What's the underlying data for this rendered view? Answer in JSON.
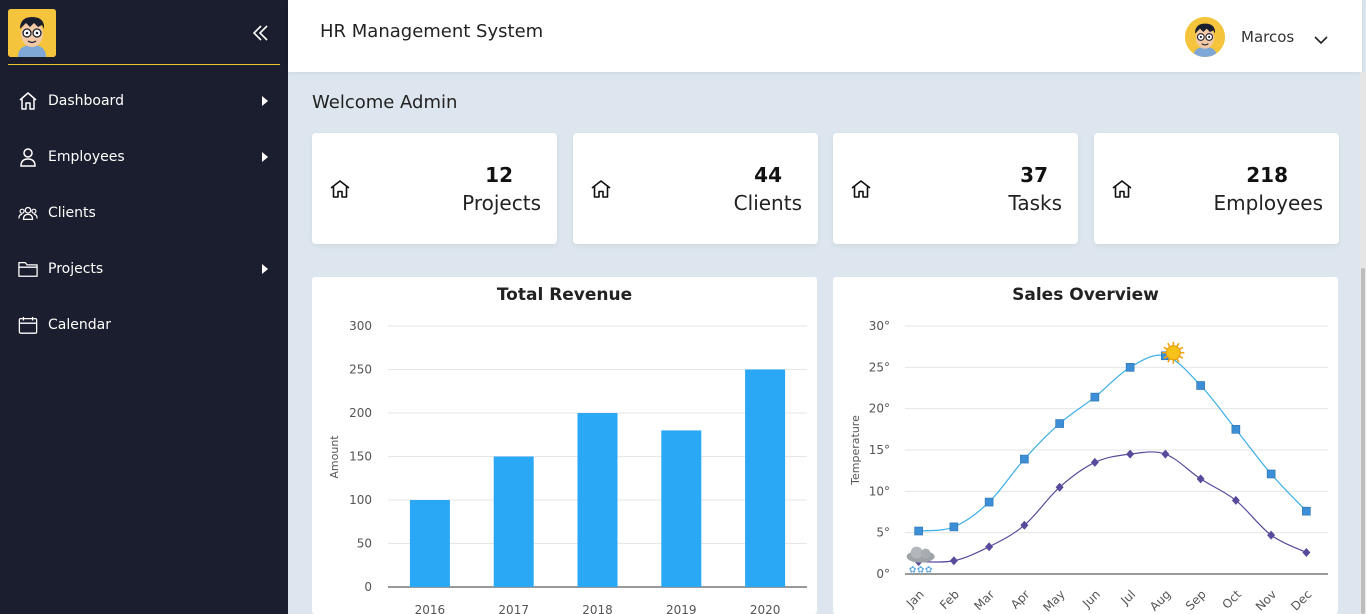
{
  "sidebar": {
    "items": [
      {
        "label": "Dashboard",
        "icon": "home-icon",
        "has_arrow": true
      },
      {
        "label": "Employees",
        "icon": "user-icon",
        "has_arrow": true
      },
      {
        "label": "Clients",
        "icon": "users-icon",
        "has_arrow": false
      },
      {
        "label": "Projects",
        "icon": "folder-icon",
        "has_arrow": true
      },
      {
        "label": "Calendar",
        "icon": "calendar-icon",
        "has_arrow": false
      }
    ],
    "divider_color": "#e9c431",
    "background": "#1b1e2e"
  },
  "header": {
    "title": "HR Management System",
    "user_name": "Marcos"
  },
  "welcome": "Welcome Admin",
  "stats": [
    {
      "value": "12",
      "label": "Projects"
    },
    {
      "value": "44",
      "label": "Clients"
    },
    {
      "value": "37",
      "label": "Tasks"
    },
    {
      "value": "218",
      "label": "Employees"
    }
  ],
  "panels": {
    "revenue_title": "Total Revenue",
    "sales_title": "Sales Overview"
  },
  "colors": {
    "accent_yellow": "#f4c53c",
    "bar_blue": "#2aa8f5",
    "line_light": "#3aaee8",
    "line_dark": "#5a4a9c"
  },
  "chart_data": [
    {
      "type": "bar",
      "title": "Total Revenue",
      "categories": [
        "2016",
        "2017",
        "2018",
        "2019",
        "2020"
      ],
      "values": [
        100,
        150,
        200,
        180,
        250
      ],
      "ylabel": "Amount",
      "ylim": [
        0,
        300
      ],
      "yticks": [
        "0",
        "50",
        "100",
        "150",
        "200",
        "250",
        "300"
      ],
      "grid": true
    },
    {
      "type": "line",
      "title": "Sales Overview",
      "categories": [
        "Jan",
        "Feb",
        "Mar",
        "Apr",
        "May",
        "Jun",
        "Jul",
        "Aug",
        "Sep",
        "Oct",
        "Nov",
        "Dec"
      ],
      "ylabel": "Temperature",
      "ylim": [
        0,
        30
      ],
      "yticks": [
        "0°",
        "5°",
        "10°",
        "15°",
        "20°",
        "25°",
        "30°"
      ],
      "grid": true,
      "series": [
        {
          "values": [
            5.2,
            5.7,
            8.7,
            13.9,
            18.2,
            21.4,
            25.0,
            26.4,
            22.8,
            17.5,
            12.1,
            7.6
          ],
          "marker": "square"
        },
        {
          "values": [
            1.5,
            1.6,
            3.3,
            5.9,
            10.5,
            13.5,
            14.5,
            14.5,
            11.5,
            8.9,
            4.7,
            2.6
          ],
          "marker": "diamond"
        }
      ]
    }
  ]
}
